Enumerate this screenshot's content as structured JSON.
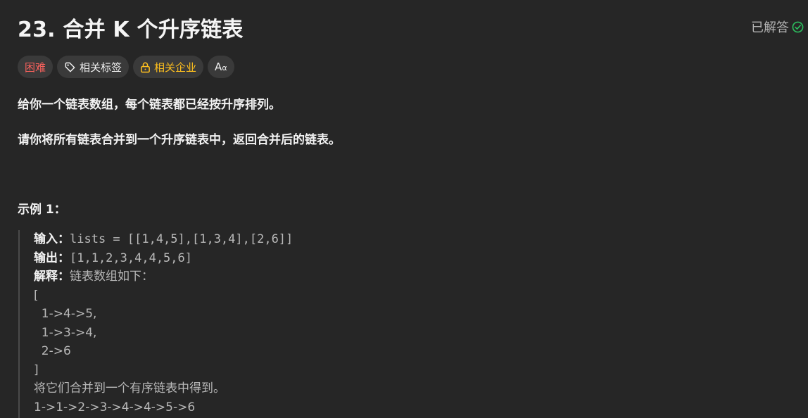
{
  "problem": {
    "title": "23. 合并 K 个升序链表",
    "status_label": "已解答",
    "tags": {
      "difficulty": "困难",
      "related_tags": "相关标签",
      "related_companies": "相关企业",
      "translate": "A"
    },
    "description": [
      "给你一个链表数组，每个链表都已经按升序排列。",
      "请你将所有链表合并到一个升序链表中，返回合并后的链表。"
    ],
    "example": {
      "title": "示例 1：",
      "input_label": "输入：",
      "input_value": "lists = [[1,4,5],[1,3,4],[2,6]]",
      "output_label": "输出：",
      "output_value": "[1,1,2,3,4,4,5,6]",
      "explain_label": "解释：",
      "explain_text": "链表数组如下：",
      "lines": [
        "[",
        "  1->4->5,",
        "  1->3->4,",
        "  2->6",
        "]",
        "将它们合并到一个有序链表中得到。",
        "1->1->2->3->4->4->5->6"
      ]
    }
  },
  "colors": {
    "background": "#262626",
    "difficulty_hard": "#f8615c",
    "company_gold": "#ffc01e",
    "solved_green": "#2cbb5d"
  },
  "icons": {
    "status": "check-circle-icon",
    "tags": "tag-icon",
    "company": "lock-icon",
    "translate": "translate-icon"
  }
}
